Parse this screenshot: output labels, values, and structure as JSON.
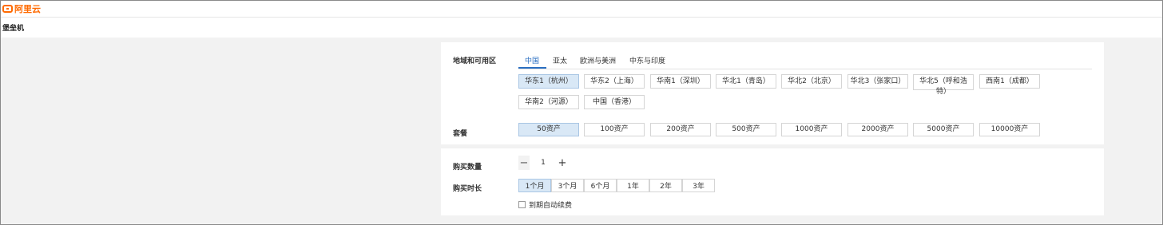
{
  "topbar": {
    "logo_text": "阿里云",
    "logo_icon": "aliyun-logo-icon",
    "accent_color": "#ff6a00"
  },
  "page": {
    "title": "堡垒机"
  },
  "region": {
    "label": "地域和可用区",
    "tabs": [
      {
        "label": "中国",
        "active": true
      },
      {
        "label": "亚太",
        "active": false
      },
      {
        "label": "欧洲与美洲",
        "active": false
      },
      {
        "label": "中东与印度",
        "active": false
      }
    ],
    "options": [
      {
        "label": "华东1（杭州）",
        "selected": true
      },
      {
        "label": "华东2（上海）",
        "selected": false
      },
      {
        "label": "华南1（深圳）",
        "selected": false
      },
      {
        "label": "华北1（青岛）",
        "selected": false
      },
      {
        "label": "华北2（北京）",
        "selected": false
      },
      {
        "label": "华北3（张家口）",
        "selected": false
      },
      {
        "label": "华北5（呼和浩特）",
        "selected": false
      },
      {
        "label": "西南1（成都）",
        "selected": false
      },
      {
        "label": "华南2（河源）",
        "selected": false
      },
      {
        "label": "中国（香港）",
        "selected": false
      }
    ]
  },
  "plan": {
    "label": "套餐",
    "options": [
      {
        "label": "50资产",
        "selected": true
      },
      {
        "label": "100资产",
        "selected": false
      },
      {
        "label": "200资产",
        "selected": false
      },
      {
        "label": "500资产",
        "selected": false
      },
      {
        "label": "1000资产",
        "selected": false
      },
      {
        "label": "2000资产",
        "selected": false
      },
      {
        "label": "5000资产",
        "selected": false
      },
      {
        "label": "10000资产",
        "selected": false
      }
    ]
  },
  "quantity": {
    "label": "购买数量",
    "value": "1",
    "minus": "−",
    "plus": "+"
  },
  "duration": {
    "label": "购买时长",
    "options": [
      {
        "label": "1个月",
        "selected": true
      },
      {
        "label": "3个月",
        "selected": false
      },
      {
        "label": "6个月",
        "selected": false
      },
      {
        "label": "1年",
        "selected": false
      },
      {
        "label": "2年",
        "selected": false
      },
      {
        "label": "3年",
        "selected": false
      }
    ]
  },
  "auto_renew": {
    "label": "到期自动续费",
    "checked": false
  },
  "colors": {
    "selected_bg": "#d9e8f6",
    "tab_active": "#2b6fc2",
    "page_bg": "#f2f2f2"
  }
}
